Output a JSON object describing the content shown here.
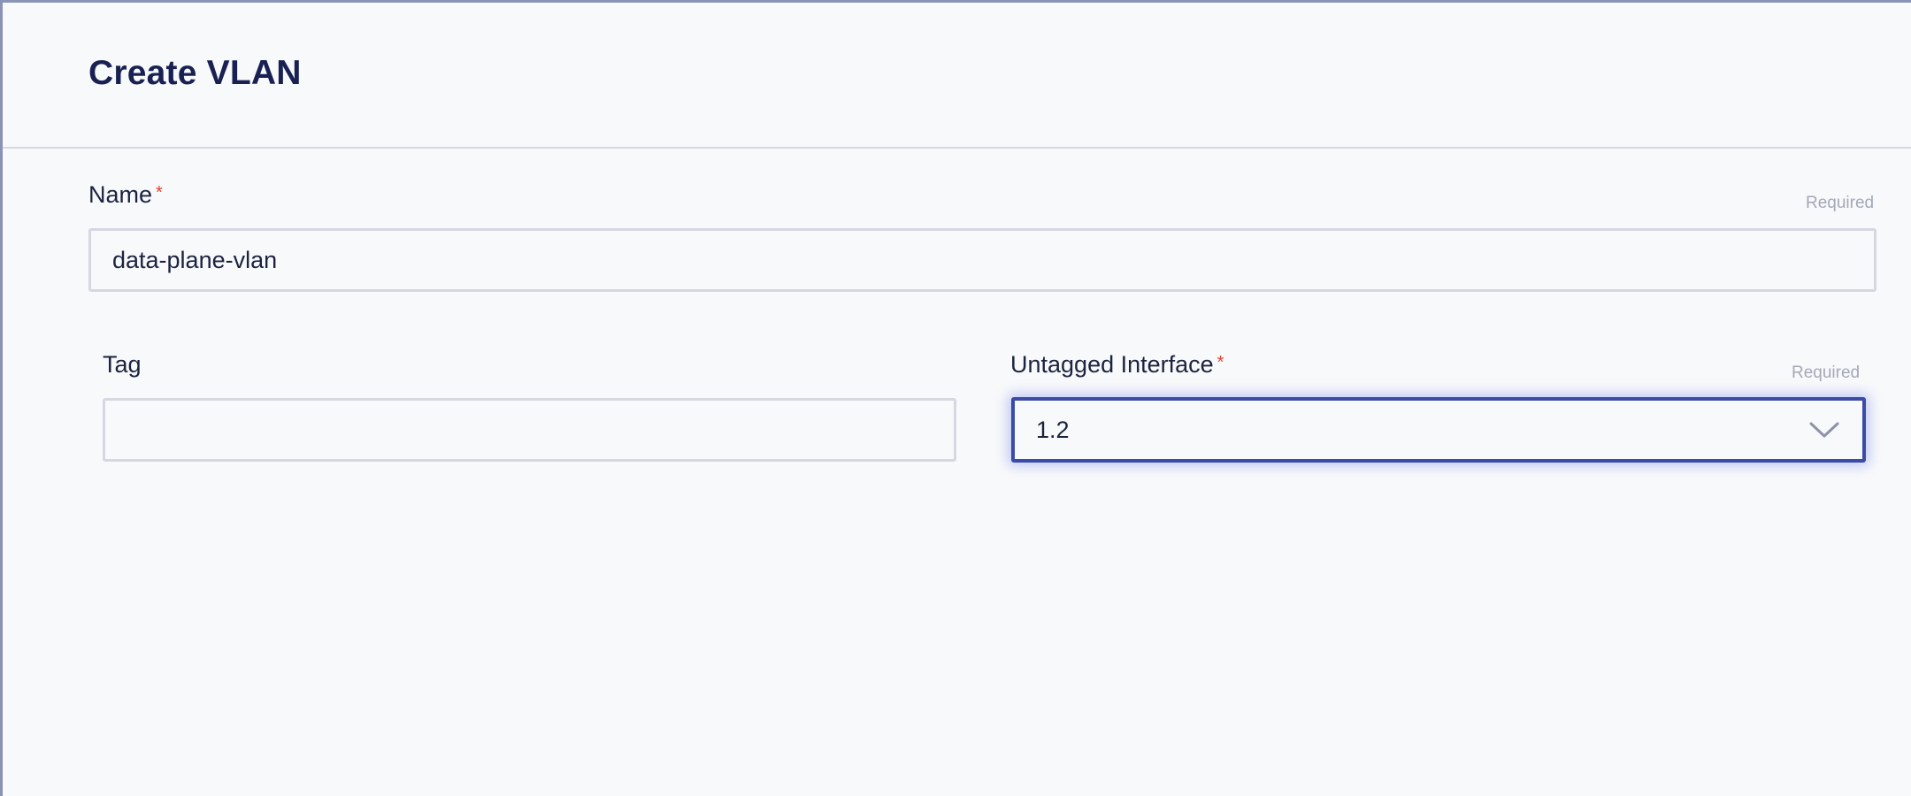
{
  "dialog": {
    "title": "Create VLAN"
  },
  "form": {
    "name": {
      "label": "Name",
      "required_mark": "*",
      "hint": "Required",
      "value": "data-plane-vlan"
    },
    "tag": {
      "label": "Tag",
      "value": ""
    },
    "untagged_interface": {
      "label": "Untagged Interface",
      "required_mark": "*",
      "hint": "Required",
      "selected": "1.2",
      "icon": "chevron-down-icon"
    }
  },
  "colors": {
    "title": "#182152",
    "required_star": "#e0402b",
    "focus_border": "#3a4ca6",
    "field_border": "#d5d8e1",
    "background": "#f8f9fb"
  }
}
